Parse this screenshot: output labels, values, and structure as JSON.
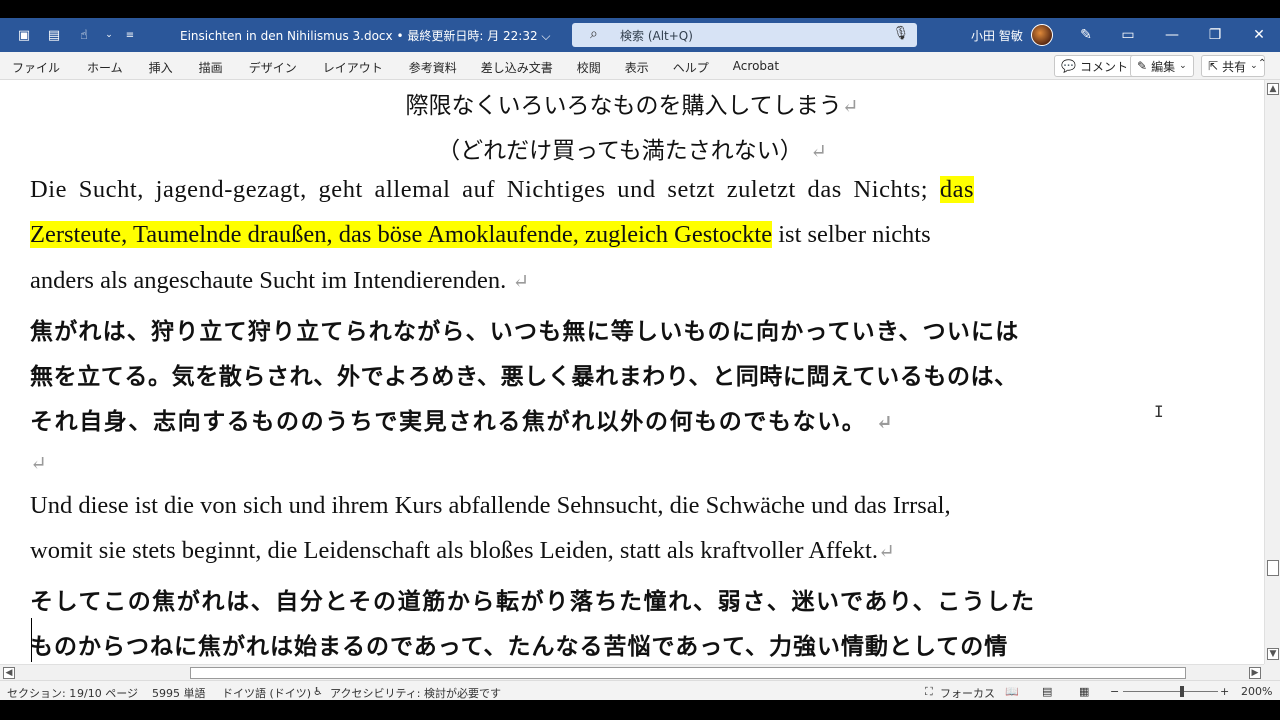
{
  "titlebar": {
    "doc_title": "Einsichten in den Nihilismus 3.docx • 最終更新日時: 月 22:32 ⌵",
    "search_icon": "search-icon",
    "search_placeholder": "検索 (Alt+Q)",
    "user_name": "小田 智敏",
    "colors": {
      "bar": "#2b579a",
      "search": "#d7e3f5"
    }
  },
  "ribbon": {
    "tabs": [
      "ファイル",
      "ホーム",
      "挿入",
      "描画",
      "デザイン",
      "レイアウト",
      "参考資料",
      "差し込み文書",
      "校閲",
      "表示",
      "ヘルプ",
      "Acrobat"
    ],
    "comment_label": "コメント",
    "edit_label": "編集",
    "share_label": "共有"
  },
  "document": {
    "line1": "際限なくいろいろなものを購入してしまう",
    "line2": "（どれだけ買っても満たされない）",
    "p1a_pre": " Die Sucht, jagend-gezagt, geht allemal auf Nichtiges und setzt zuletzt das Nichts; ",
    "p1a_hl": "das",
    "p1b_hl": "Zersteute, Taumelnde draußen, das böse Amoklaufende, zugleich Gestockte",
    "p1b_post": " ist selber nichts",
    "p1c": "anders als angeschaute Sucht im Intendierenden.",
    "jp1": "焦がれは、狩り立て狩り立てられながら、いつも無に等しいものに向かっていき、ついには",
    "jp2": "無を立てる。気を散らされ、外でよろめき、悪しく暴れまわり、と同時に閊えているものは、",
    "jp3": "それ自身、志向するもののうちで実見される焦がれ以外の何ものでもない。",
    "p2a": "Und diese ist die von sich und ihrem Kurs abfallende Sehnsucht, die Schwäche und das Irrsal,",
    "p2b": "womit sie stets beginnt, die Leidenschaft als bloßes Leiden, statt als kraftvoller Affekt.",
    "jp4": "そしてこの焦がれは、自分とその道筋から転がり落ちた憧れ、弱さ、迷いであり、こうした",
    "jp5": "ものからつねに焦がれは始まるのであって、たんなる苦悩であって、力強い情動としての情",
    "paragraph_mark": "↵",
    "highlight_color": "#ffff00"
  },
  "statusbar": {
    "section": "セクション: 1",
    "page": "9/10 ページ",
    "words": "5995 単語",
    "language": "ドイツ語 (ドイツ)",
    "accessibility": "アクセシビリティ: 検討が必要です",
    "focus": "フォーカス",
    "zoom": "200%"
  }
}
